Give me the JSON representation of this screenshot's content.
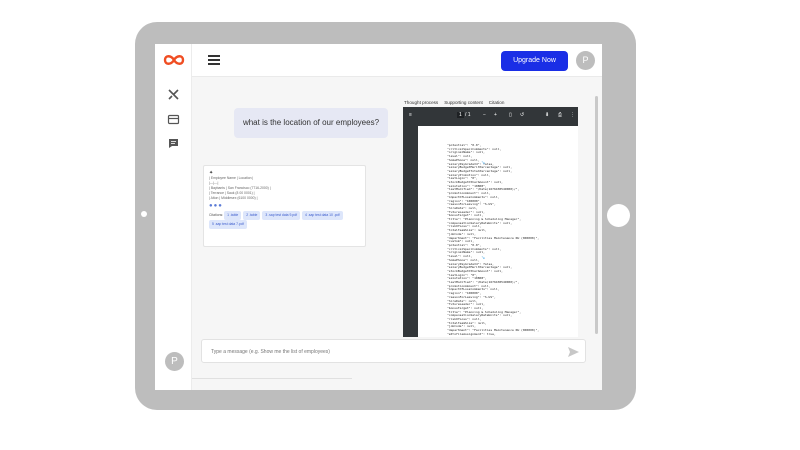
{
  "colors": {
    "accent": "#1a2ee6",
    "tablet_frame": "#bdbdbd",
    "logo": "#f04e23"
  },
  "header": {
    "upgrade_label": "Upgrade Now",
    "avatar_initial": "P"
  },
  "sidebar": {
    "icons": [
      "tools-icon",
      "card-icon",
      "chat-icon"
    ],
    "avatar_initial": "P"
  },
  "chat": {
    "question": "what is the location of our employees?",
    "answer_lines": [
      "| Employee Name | Location |",
      "|---|---|",
      "| Baybants | San Francisco (7716-2000) |",
      "| Terrance | Sauk (8 00 0001) |",
      "| Alton | Middlesex (6100 0000) |"
    ],
    "citations_label": "Citations:",
    "citations": [
      "1 .table",
      "2 .table",
      "3 .sap test data 9.pdf",
      "4 .sap test data 10 .pdf",
      "5 .sap test data 7.pdf"
    ],
    "composer_placeholder": "Type a message (e.g. Show me the list of employees)"
  },
  "panel": {
    "tabs": [
      "Thought process",
      "Supporting content",
      "Citation"
    ],
    "toolbar": {
      "page": "1",
      "page_total": "/ 1"
    },
    "doc_lines": [
      "\"potential\": \"0.0\",",
      "\"criticalSpeciComments\": null,",
      "\"originalName\": null,",
      "\"level\": null,",
      "\"homePhone\": null,",
      "\"salaryPayGradeId\": false,",
      "\"salaryBudgetMeritPercentage\": null,",
      "\"salaryBudgetTotalPercentage\": null,",
      "\"salaryPromotion\": null,",
      "\"lastLogin\": \"0\",",
      "\"stockBudgetOtherAmount\": null,",
      "\"salutation\": \"10808\",",
      "\"lastModified\": \"/Date(1676430549000)/\",",
      "\"promotionAmount\": null,",
      "\"impactOfLossComments\": null,",
      "\"region\": \"100000\",",
      "\"reasonForLeaving\": \"S-US\",",
      "\"hireDate\": null,",
      "\"futureLeader\": null,",
      "\"bonusTarget\": null,",
      "\"title\": \"Planning & Scheduling Manager\",",
      "\"compensationSalaryRateUnits\": null,",
      "\"riskOfLoss\": null,",
      "\"totalTeamSize\": null,",
      "\"jobCode\": null,",
      "\"department\": \"Facilities Maintenance RU (000000)\",",
      "\"custom\": null,",
      "\"potential\": \"0.0\",",
      "\"criticalSpeciComments\": null,",
      "\"originalName\": null,",
      "\"level\": null,",
      "\"homePhone\": null,",
      "\"salaryPayGradeId\": false,",
      "\"salaryBudgetMeritPercentage\": null,",
      "\"stockBudgetOtherAmount\": null,",
      "\"lastLogin\": \"0\",",
      "\"salutation\": \"10808\",",
      "\"lastModified\": \"/Date(1676430549000)/\",",
      "\"promotionAmount\": null,",
      "\"impactOfLossComments\": null,",
      "\"region\": \"100000\",",
      "\"reasonForLeaving\": \"S-US\",",
      "\"hireDate\": null,",
      "\"futureLeader\": null,",
      "\"bonusTarget\": null,",
      "\"title\": \"Planning & Scheduling Manager\",",
      "\"compensationSalaryRateUnits\": null,",
      "\"riskOfLoss\": null,",
      "\"totalTeamSize\": null,",
      "\"jobCode\": null,",
      "\"department\": \"Facilities Maintenance RU (000000)\",",
      "\"eProfileAssignment\": true,"
    ]
  }
}
